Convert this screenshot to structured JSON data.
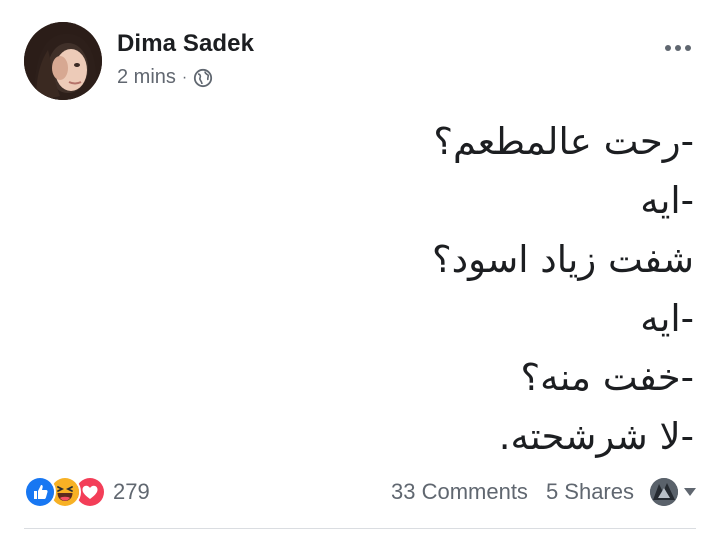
{
  "post": {
    "author": "Dima Sadek",
    "timestamp": "2 mins",
    "separator": "·",
    "privacy_icon": "globe-icon",
    "more_icon": "more-options-icon",
    "text_lines": [
      "-رحت عالمطعم؟",
      "-ايه",
      "شفت زياد اسود؟",
      "-ايه",
      "-خفت منه؟",
      "-لا شرشحته."
    ]
  },
  "footer": {
    "reaction_icons": [
      "like-icon",
      "haha-icon",
      "love-icon"
    ],
    "reaction_count": "279",
    "comments": "33 Comments",
    "shares": "5 Shares"
  },
  "colors": {
    "text": "#1c1e21",
    "secondary": "#616770",
    "like_blue": "#1877f2",
    "haha_yellow": "#f7b125",
    "love_red": "#f33e58"
  }
}
